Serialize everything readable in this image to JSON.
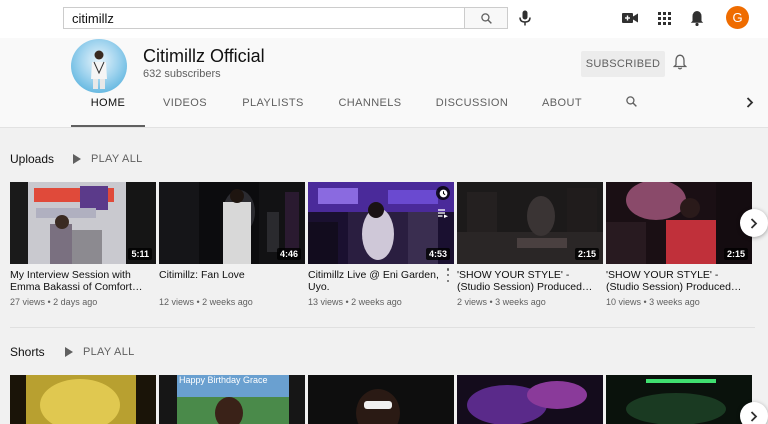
{
  "header": {
    "search_value": "citimillz",
    "icons": [
      "search-icon",
      "mic-icon",
      "video-camera-icon",
      "apps-grid-icon",
      "notifications-bell-icon"
    ],
    "avatar_letter": "G",
    "avatar_color": "#ef6c00"
  },
  "channel": {
    "name": "Citimillz Official",
    "subscribers": "632 subscribers",
    "subscribe_label": "SUBSCRIBED"
  },
  "tabs": [
    {
      "label": "HOME",
      "active": true
    },
    {
      "label": "VIDEOS"
    },
    {
      "label": "PLAYLISTS"
    },
    {
      "label": "CHANNELS"
    },
    {
      "label": "DISCUSSION"
    },
    {
      "label": "ABOUT"
    }
  ],
  "uploads": {
    "title": "Uploads",
    "play_all": "PLAY ALL",
    "videos": [
      {
        "title": "My Interview Session with Emma Bakassi of Comfort…",
        "views": "27 views",
        "age": "2 days ago",
        "duration": "5:11"
      },
      {
        "title": "Citimillz: Fan Love",
        "views": "12 views",
        "age": "2 weeks ago",
        "duration": "4:46"
      },
      {
        "title": "Citimillz Live @ Eni Garden, Uyo.",
        "views": "13 views",
        "age": "2 weeks ago",
        "duration": "4:53"
      },
      {
        "title": "'SHOW YOUR STYLE' - (Studio Session) Produced…",
        "views": "2 views",
        "age": "3 weeks ago",
        "duration": "2:15"
      },
      {
        "title": "'SHOW YOUR STYLE' - (Studio Session) Produced…",
        "views": "10 views",
        "age": "3 weeks ago",
        "duration": "2:15"
      }
    ]
  },
  "shorts": {
    "title": "Shorts",
    "play_all": "PLAY ALL",
    "thumb_text": "Happy Birthday Grace"
  }
}
